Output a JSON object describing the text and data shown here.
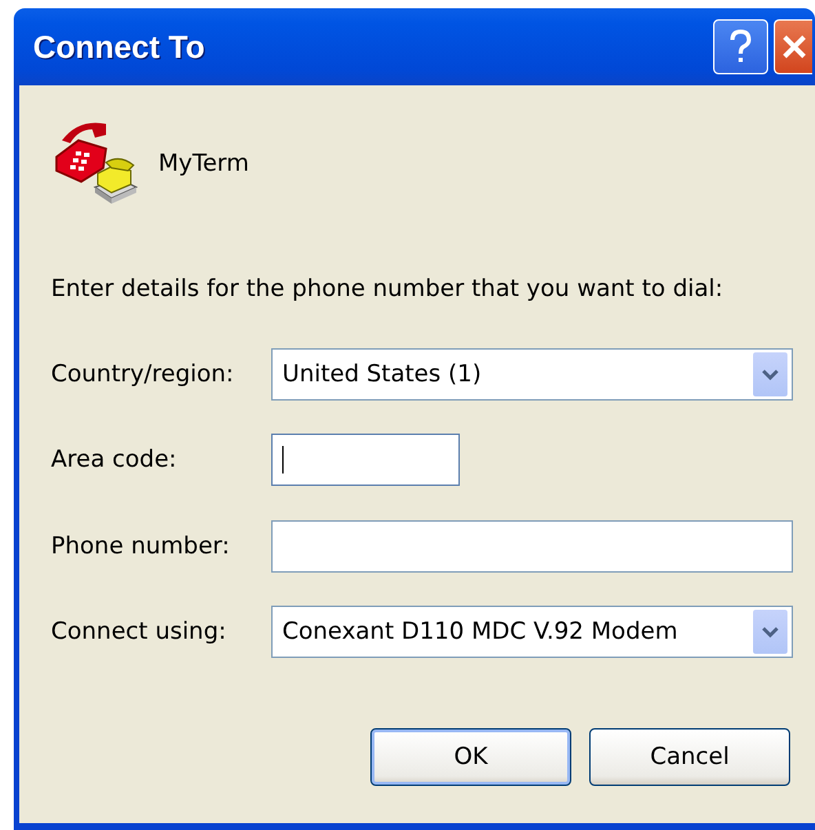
{
  "window": {
    "title": "Connect To"
  },
  "connection": {
    "name": "MyTerm"
  },
  "instruction": "Enter details for the phone number that you want to dial:",
  "fields": [
    {
      "kind": "dropdown",
      "label": "Country/region:",
      "value": "United States (1)"
    },
    {
      "kind": "short-text",
      "label": "Area code:",
      "focused": true
    },
    {
      "kind": "text",
      "label": "Phone number:",
      "focused": false
    },
    {
      "kind": "dropdown",
      "label": "Connect using:",
      "value": "Conexant D110 MDC V.92 Modem"
    }
  ],
  "buttons": [
    {
      "label": "OK",
      "default": true
    },
    {
      "label": "Cancel",
      "default": false
    }
  ]
}
